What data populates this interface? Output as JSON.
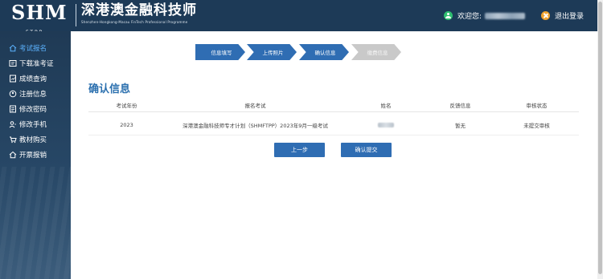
{
  "header": {
    "logo_mark": "SHM",
    "logo_sub": "FTPP",
    "logo_cn": "深港澳金融科技师",
    "logo_en": "Shenzhen-Hongkong-Macau FinTech Professional Programme",
    "welcome_label": "欢迎您:",
    "logout_label": "退出登录"
  },
  "sidebar": {
    "items": [
      {
        "label": "考试报名",
        "icon": "home-icon"
      },
      {
        "label": "下载准考证",
        "icon": "id-card-icon"
      },
      {
        "label": "成绩查询",
        "icon": "report-icon"
      },
      {
        "label": "注册信息",
        "icon": "register-icon"
      },
      {
        "label": "修改密码",
        "icon": "password-icon"
      },
      {
        "label": "修改手机",
        "icon": "phone-user-icon"
      },
      {
        "label": "教材购买",
        "icon": "cart-icon"
      },
      {
        "label": "开票报销",
        "icon": "invoice-icon"
      }
    ]
  },
  "steps": [
    "信息填写",
    "上传照片",
    "确认信息",
    "缴费信息"
  ],
  "section_title": "确认信息",
  "table": {
    "headers": [
      "考试年份",
      "报名考试",
      "姓名",
      "反馈信息",
      "审核状态"
    ],
    "rows": [
      {
        "year": "2023",
        "exam": "深港澳金融科技师专才计划（SHMFTPP）2023年9月一级考试",
        "feedback": "暂无",
        "status": "未提交审核"
      }
    ]
  },
  "buttons": {
    "prev": "上一步",
    "submit": "确认提交"
  },
  "colors": {
    "header_bg": "#1d3a57",
    "accent": "#2f6db3",
    "active_nav": "#5cb3ff",
    "pending_step": "#c9c9c9"
  }
}
